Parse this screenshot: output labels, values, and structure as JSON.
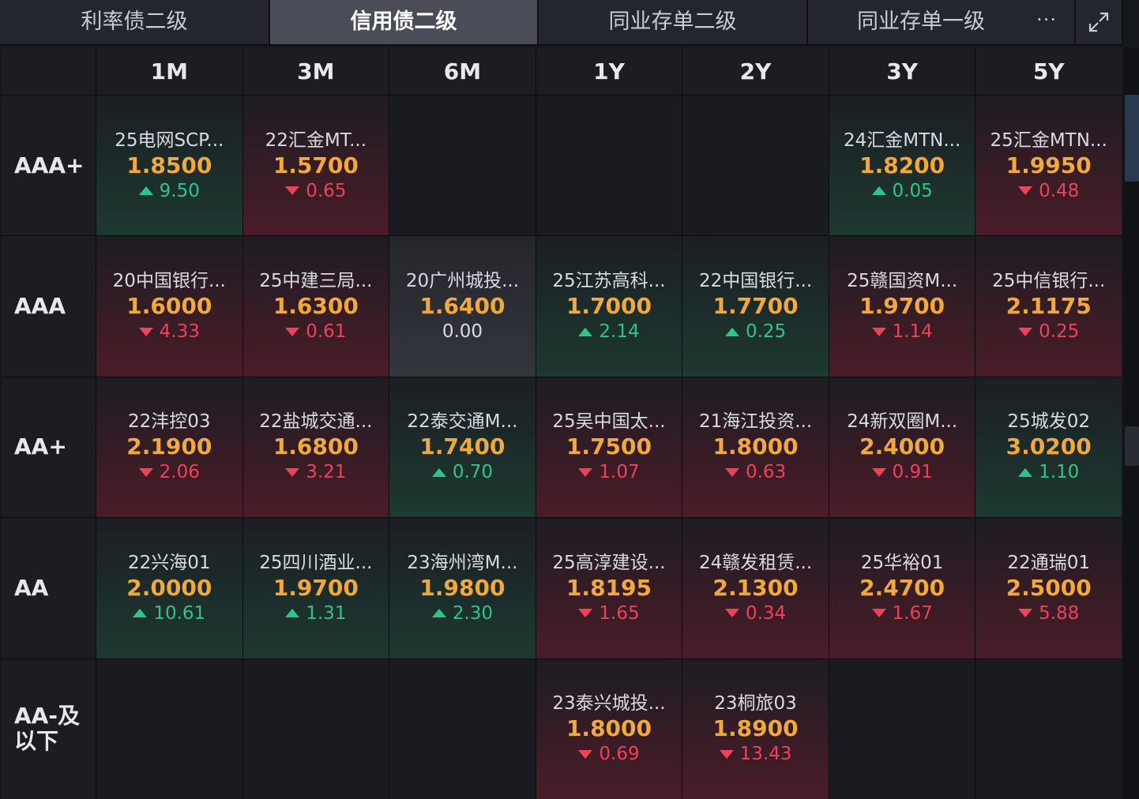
{
  "tabs": [
    {
      "label": "利率债二级",
      "active": false
    },
    {
      "label": "信用债二级",
      "active": true
    },
    {
      "label": "同业存单二级",
      "active": false
    },
    {
      "label": "同业存单一级",
      "active": false
    }
  ],
  "more_label": "···",
  "columns": [
    "1M",
    "3M",
    "6M",
    "1Y",
    "2Y",
    "3Y",
    "5Y"
  ],
  "rows": [
    {
      "rating": "AAA+",
      "cells": [
        {
          "name": "25电网SCP...",
          "yield": "1.8500",
          "change": "9.50",
          "dir": "up"
        },
        {
          "name": "22汇金MT...",
          "yield": "1.5700",
          "change": "0.65",
          "dir": "down"
        },
        null,
        null,
        null,
        {
          "name": "24汇金MTN...",
          "yield": "1.8200",
          "change": "0.05",
          "dir": "up"
        },
        {
          "name": "25汇金MTN...",
          "yield": "1.9950",
          "change": "0.48",
          "dir": "down"
        }
      ]
    },
    {
      "rating": "AAA",
      "cells": [
        {
          "name": "20中国银行...",
          "yield": "1.6000",
          "change": "4.33",
          "dir": "down"
        },
        {
          "name": "25中建三局...",
          "yield": "1.6300",
          "change": "0.61",
          "dir": "down"
        },
        {
          "name": "20广州城投...",
          "yield": "1.6400",
          "change": "0.00",
          "dir": "flat"
        },
        {
          "name": "25江苏高科...",
          "yield": "1.7000",
          "change": "2.14",
          "dir": "up"
        },
        {
          "name": "22中国银行...",
          "yield": "1.7700",
          "change": "0.25",
          "dir": "up"
        },
        {
          "name": "25赣国资M...",
          "yield": "1.9700",
          "change": "1.14",
          "dir": "down"
        },
        {
          "name": "25中信银行...",
          "yield": "2.1175",
          "change": "0.25",
          "dir": "down"
        }
      ]
    },
    {
      "rating": "AA+",
      "cells": [
        {
          "name": "22沣控03",
          "yield": "2.1900",
          "change": "2.06",
          "dir": "down"
        },
        {
          "name": "22盐城交通...",
          "yield": "1.6800",
          "change": "3.21",
          "dir": "down"
        },
        {
          "name": "22泰交通M...",
          "yield": "1.7400",
          "change": "0.70",
          "dir": "up"
        },
        {
          "name": "25吴中国太...",
          "yield": "1.7500",
          "change": "1.07",
          "dir": "down"
        },
        {
          "name": "21海江投资...",
          "yield": "1.8000",
          "change": "0.63",
          "dir": "down"
        },
        {
          "name": "24新双圈M...",
          "yield": "2.4000",
          "change": "0.91",
          "dir": "down"
        },
        {
          "name": "25城发02",
          "yield": "3.0200",
          "change": "1.10",
          "dir": "up"
        }
      ]
    },
    {
      "rating": "AA",
      "cells": [
        {
          "name": "22兴海01",
          "yield": "2.0000",
          "change": "10.61",
          "dir": "up"
        },
        {
          "name": "25四川酒业...",
          "yield": "1.9700",
          "change": "1.31",
          "dir": "up"
        },
        {
          "name": "23海州湾M...",
          "yield": "1.9800",
          "change": "2.30",
          "dir": "up"
        },
        {
          "name": "25高淳建设...",
          "yield": "1.8195",
          "change": "1.65",
          "dir": "down"
        },
        {
          "name": "24赣发租赁...",
          "yield": "2.1300",
          "change": "0.34",
          "dir": "down"
        },
        {
          "name": "25华裕01",
          "yield": "2.4700",
          "change": "1.67",
          "dir": "down"
        },
        {
          "name": "22通瑞01",
          "yield": "2.5000",
          "change": "5.88",
          "dir": "down"
        }
      ]
    },
    {
      "rating": "AA-及以下",
      "rating_lines": [
        "AA-及",
        "以下"
      ],
      "cells": [
        null,
        null,
        null,
        {
          "name": "23泰兴城投...",
          "yield": "1.8000",
          "change": "0.69",
          "dir": "down"
        },
        {
          "name": "23桐旅03",
          "yield": "1.8900",
          "change": "13.43",
          "dir": "down"
        },
        null,
        null
      ]
    }
  ],
  "colors": {
    "yield": "#f2a93b",
    "up": "#2ec58a",
    "down": "#f0415a",
    "active_tab": "#4a4d57"
  }
}
